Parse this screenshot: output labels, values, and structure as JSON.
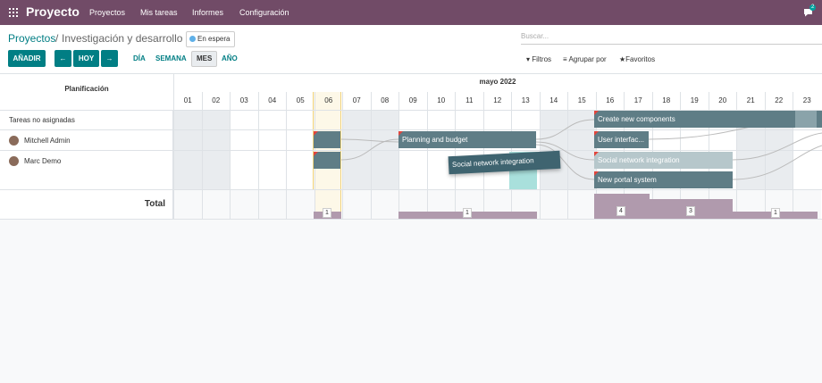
{
  "navbar": {
    "brand": "Proyecto",
    "menu": [
      "Proyectos",
      "Mis tareas",
      "Informes",
      "Configuración"
    ],
    "chat_badge": "2"
  },
  "breadcrumb": {
    "parent": "Proyectos",
    "separator": "/",
    "current": "Investigación y desarrollo",
    "status": "En espera"
  },
  "search": {
    "placeholder": "Buscar..."
  },
  "toolbar": {
    "add": "AÑADIR",
    "prev": "←",
    "today": "HOY",
    "next": "→",
    "scales": [
      "DÍA",
      "SEMANA",
      "MES",
      "AÑO"
    ],
    "active_scale": "MES",
    "filters": "Filtros",
    "group_by": "Agrupar por",
    "favorites": "Favoritos"
  },
  "gantt": {
    "title": "Planificación",
    "month": "mayo 2022",
    "days": [
      "01",
      "02",
      "03",
      "04",
      "05",
      "06",
      "07",
      "08",
      "09",
      "10",
      "11",
      "12",
      "13",
      "14",
      "15",
      "16",
      "17",
      "18",
      "19",
      "20",
      "21",
      "22",
      "23"
    ],
    "rows": [
      "Tareas no asignadas",
      "Mitchell Admin",
      "Marc Demo"
    ],
    "tasks": {
      "create_components": "Create new components",
      "planning_budget": "Planning and budget",
      "user_interface": "User interfac...",
      "social_network_drag": "Social network integration",
      "social_network": "Social network integration",
      "portal": "New portal system"
    },
    "total_label": "Total",
    "totals": [
      "1",
      "1",
      "4",
      "3",
      "1"
    ]
  },
  "colors": {
    "navbar": "#714b67",
    "primary": "#017e84",
    "pill": "#5f7d86",
    "total_bar": "#b09aad",
    "today": "#fdf8e8"
  }
}
